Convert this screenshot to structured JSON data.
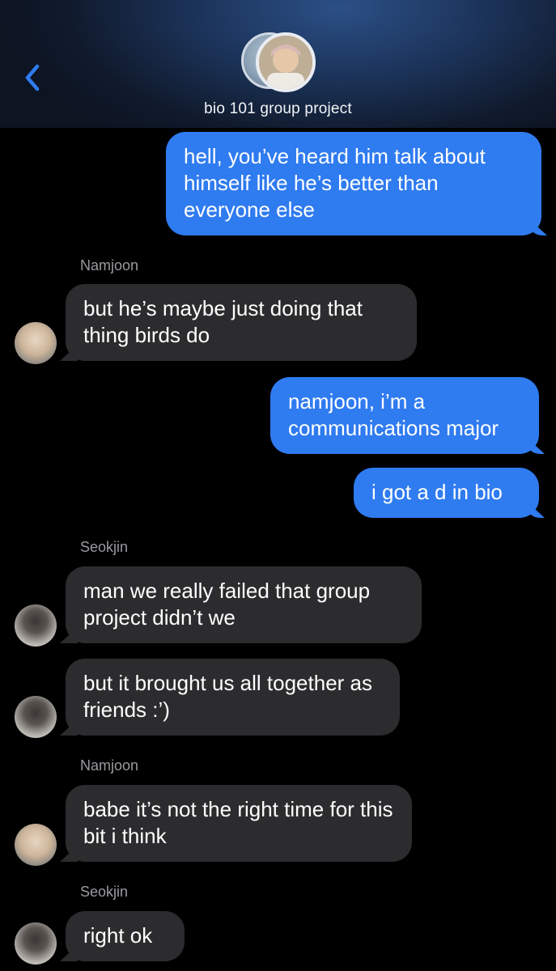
{
  "header": {
    "title": "bio 101 group project",
    "back_icon": "chevron-left-icon",
    "accent": "#2f7bf0"
  },
  "messages": [
    {
      "from": "me",
      "text": "hell, you’ve heard him talk about himself like he’s better than everyone else"
    },
    {
      "sender": "Namjoon"
    },
    {
      "from": "Namjoon",
      "text": "but he’s maybe just doing that thing birds do"
    },
    {
      "from": "me",
      "text": "namjoon, i’m a communications major"
    },
    {
      "from": "me",
      "text": "i got a d in bio"
    },
    {
      "sender": "Seokjin"
    },
    {
      "from": "Seokjin",
      "text": "man we really failed that group project didn’t we"
    },
    {
      "from": "Seokjin",
      "text": "but it brought us all together as friends :’)"
    },
    {
      "sender": "Namjoon"
    },
    {
      "from": "Namjoon",
      "text": "babe it’s not the right time for this bit i think"
    },
    {
      "sender": "Seokjin"
    },
    {
      "from": "Seokjin",
      "text": "right ok"
    }
  ],
  "colors": {
    "outgoing_bubble": "#2f7bf0",
    "incoming_bubble": "#2c2c2e",
    "sender_label": "#9a9aa0"
  }
}
